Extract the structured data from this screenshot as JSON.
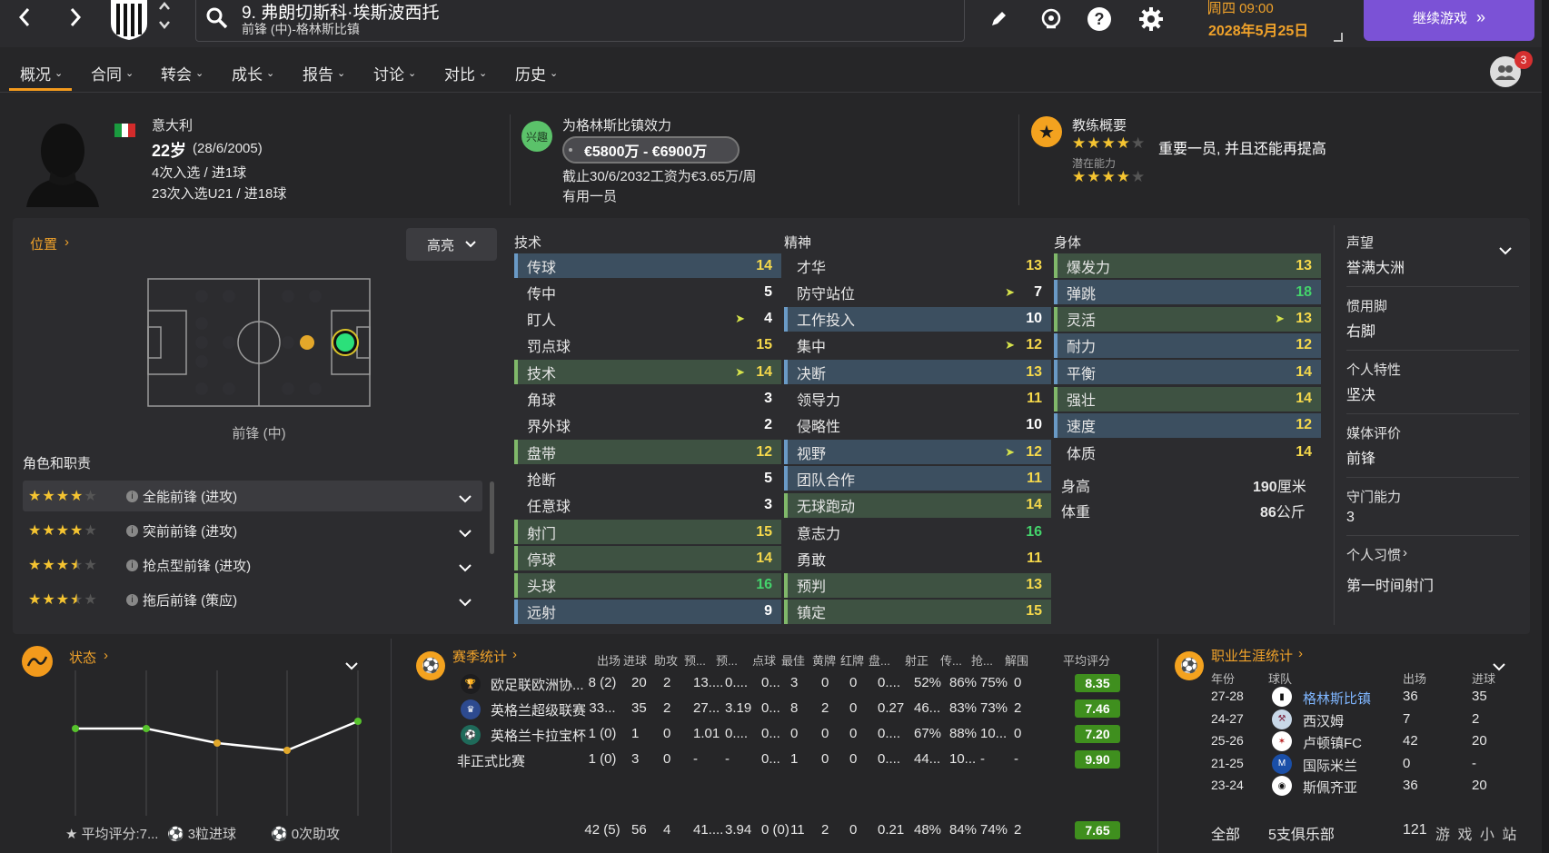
{
  "topbar": {
    "player_title": "9. 弗朗切斯科·埃斯波西托",
    "player_subtitle": "前锋 (中)-格林斯比镇",
    "day_time": "周四 09:00",
    "date": "2028年5月25日",
    "continue_label": "继续游戏",
    "notification_count": "3"
  },
  "tabs": [
    {
      "label": "概况"
    },
    {
      "label": "合同"
    },
    {
      "label": "转会"
    },
    {
      "label": "成长"
    },
    {
      "label": "报告"
    },
    {
      "label": "讨论"
    },
    {
      "label": "对比"
    },
    {
      "label": "历史"
    }
  ],
  "profile": {
    "nationality": "意大利",
    "age": "22岁",
    "birth": "(28/6/2005)",
    "caps": "4次入选 / 进1球",
    "u21_caps": "23次入选U21 / 进18球"
  },
  "contract": {
    "badge": "兴趣",
    "club_line": "为格林斯比镇效力",
    "value": "€5800万 - €6900万",
    "wage": "截止30/6/2032工资为€3.65万/周",
    "status": "有用一员"
  },
  "coach": {
    "title": "教练概要",
    "current_stars": 4,
    "summary": "重要一员, 并且还能再提高",
    "potential_label": "潜在能力",
    "potential_stars": 4
  },
  "position": {
    "title": "位置",
    "highlight_label": "高亮",
    "position_name": "前锋 (中)",
    "roles_title": "角色和职责",
    "roles": [
      {
        "stars": 4,
        "name": "全能前锋 (进攻)"
      },
      {
        "stars": 4,
        "name": "突前前锋 (进攻)"
      },
      {
        "stars": 3.5,
        "name": "抢点型前锋 (进攻)"
      },
      {
        "stars": 3.5,
        "name": "拖后前锋 (策应)"
      }
    ]
  },
  "attributes": {
    "technical_title": "技术",
    "mental_title": "精神",
    "physical_title": "身体",
    "technical": [
      {
        "name": "传球",
        "value": "14",
        "hl": "blue",
        "arrow": false
      },
      {
        "name": "传中",
        "value": "5",
        "hl": "",
        "arrow": false
      },
      {
        "name": "盯人",
        "value": "4",
        "hl": "",
        "arrow": true
      },
      {
        "name": "罚点球",
        "value": "15",
        "hl": "",
        "arrow": false
      },
      {
        "name": "技术",
        "value": "14",
        "hl": "green",
        "arrow": true
      },
      {
        "name": "角球",
        "value": "3",
        "hl": "",
        "arrow": false
      },
      {
        "name": "界外球",
        "value": "2",
        "hl": "",
        "arrow": false
      },
      {
        "name": "盘带",
        "value": "12",
        "hl": "green",
        "arrow": false
      },
      {
        "name": "抢断",
        "value": "5",
        "hl": "",
        "arrow": false
      },
      {
        "name": "任意球",
        "value": "3",
        "hl": "",
        "arrow": false
      },
      {
        "name": "射门",
        "value": "15",
        "hl": "green",
        "arrow": false
      },
      {
        "name": "停球",
        "value": "14",
        "hl": "green",
        "arrow": false
      },
      {
        "name": "头球",
        "value": "16",
        "hl": "green",
        "arrow": false
      },
      {
        "name": "远射",
        "value": "9",
        "hl": "blue",
        "arrow": false
      }
    ],
    "mental": [
      {
        "name": "才华",
        "value": "13",
        "hl": "",
        "arrow": false
      },
      {
        "name": "防守站位",
        "value": "7",
        "hl": "",
        "arrow": true
      },
      {
        "name": "工作投入",
        "value": "10",
        "hl": "blue",
        "arrow": false
      },
      {
        "name": "集中",
        "value": "12",
        "hl": "",
        "arrow": true
      },
      {
        "name": "决断",
        "value": "13",
        "hl": "blue",
        "arrow": false
      },
      {
        "name": "领导力",
        "value": "11",
        "hl": "",
        "arrow": false
      },
      {
        "name": "侵略性",
        "value": "10",
        "hl": "",
        "arrow": false
      },
      {
        "name": "视野",
        "value": "12",
        "hl": "blue",
        "arrow": true
      },
      {
        "name": "团队合作",
        "value": "11",
        "hl": "blue",
        "arrow": false
      },
      {
        "name": "无球跑动",
        "value": "14",
        "hl": "green",
        "arrow": false
      },
      {
        "name": "意志力",
        "value": "16",
        "hl": "",
        "arrow": false
      },
      {
        "name": "勇敢",
        "value": "11",
        "hl": "",
        "arrow": false
      },
      {
        "name": "预判",
        "value": "13",
        "hl": "green",
        "arrow": false
      },
      {
        "name": "镇定",
        "value": "15",
        "hl": "green",
        "arrow": false
      }
    ],
    "physical": [
      {
        "name": "爆发力",
        "value": "13",
        "hl": "green",
        "arrow": false
      },
      {
        "name": "弹跳",
        "value": "18",
        "hl": "blue",
        "arrow": false
      },
      {
        "name": "灵活",
        "value": "13",
        "hl": "green",
        "arrow": true
      },
      {
        "name": "耐力",
        "value": "12",
        "hl": "blue",
        "arrow": false
      },
      {
        "name": "平衡",
        "value": "14",
        "hl": "blue",
        "arrow": false
      },
      {
        "name": "强壮",
        "value": "14",
        "hl": "green",
        "arrow": false
      },
      {
        "name": "速度",
        "value": "12",
        "hl": "blue",
        "arrow": false
      },
      {
        "name": "体质",
        "value": "14",
        "hl": "",
        "arrow": false
      }
    ],
    "height_label": "身高",
    "height_value": "190",
    "height_unit": "厘米",
    "weight_label": "体重",
    "weight_value": "86",
    "weight_unit": "公斤"
  },
  "info": {
    "reputation_label": "声望",
    "reputation_value": "誉满大洲",
    "foot_label": "惯用脚",
    "foot_value": "右脚",
    "personality_label": "个人特性",
    "personality_value": "坚决",
    "media_label": "媒体评价",
    "media_value": "前锋",
    "gk_label": "守门能力",
    "gk_value": "3",
    "habits_label": "个人习惯",
    "habits_value": "第一时间射门"
  },
  "form": {
    "title": "状态",
    "avg_rating": "平均评分:7...",
    "goals": "3粒进球",
    "assists": "0次助攻",
    "points": [
      7.2,
      7.2,
      7.0,
      6.9,
      7.3
    ]
  },
  "season": {
    "title": "赛季统计",
    "headers": [
      "出场",
      "进球",
      "助攻",
      "预...",
      "预...",
      "点球",
      "最佳",
      "黄牌",
      "红牌",
      "盘...",
      "射正",
      "传...",
      "抢...",
      "解围",
      "平均评分"
    ],
    "rows": [
      {
        "comp": "欧足联欧洲协...",
        "cells": [
          "8 (2)",
          "20",
          "2",
          "13....",
          "0....",
          "0...",
          "3",
          "0",
          "0",
          "0....",
          "52%",
          "86%",
          "75%",
          "0"
        ],
        "rating": "8.35"
      },
      {
        "comp": "英格兰超级联赛",
        "cells": [
          "33...",
          "35",
          "2",
          "27...",
          "3.19",
          "0...",
          "8",
          "2",
          "0",
          "0.27",
          "46...",
          "83%",
          "73%",
          "2"
        ],
        "rating": "7.46"
      },
      {
        "comp": "英格兰卡拉宝杯",
        "cells": [
          "1 (0)",
          "1",
          "0",
          "1.01",
          "0....",
          "0...",
          "0",
          "0",
          "0",
          "0....",
          "67%",
          "88%",
          "10...",
          "0"
        ],
        "rating": "7.20"
      },
      {
        "comp": "非正式比赛",
        "cells": [
          "1 (0)",
          "3",
          "0",
          "-",
          "-",
          "0...",
          "1",
          "0",
          "0",
          "0....",
          "44...",
          "10...",
          "-",
          "-"
        ],
        "rating": "9.90"
      }
    ],
    "total": {
      "cells": [
        "42 (5)",
        "56",
        "4",
        "41....",
        "3.94",
        "0 (0)",
        "11",
        "2",
        "0",
        "0.21",
        "48%",
        "84%",
        "74%",
        "2"
      ],
      "rating": "7.65"
    }
  },
  "career": {
    "title": "职业生涯统计",
    "headers": {
      "year": "年份",
      "team": "球队",
      "apps": "出场",
      "goals": "进球"
    },
    "rows": [
      {
        "year": "27-28",
        "team": "格林斯比镇",
        "apps": "36",
        "goals": "35"
      },
      {
        "year": "24-27",
        "team": "西汉姆",
        "apps": "7",
        "goals": "2"
      },
      {
        "year": "25-26",
        "team": "卢顿镇FC",
        "apps": "42",
        "goals": "20"
      },
      {
        "year": "21-25",
        "team": "国际米兰",
        "apps": "0",
        "goals": "-"
      },
      {
        "year": "23-24",
        "team": "斯佩齐亚",
        "apps": "36",
        "goals": "20"
      }
    ],
    "total_label": "全部",
    "total_clubs": "5支俱乐部",
    "total_apps": "121"
  },
  "watermark": "游 戏 小 站"
}
